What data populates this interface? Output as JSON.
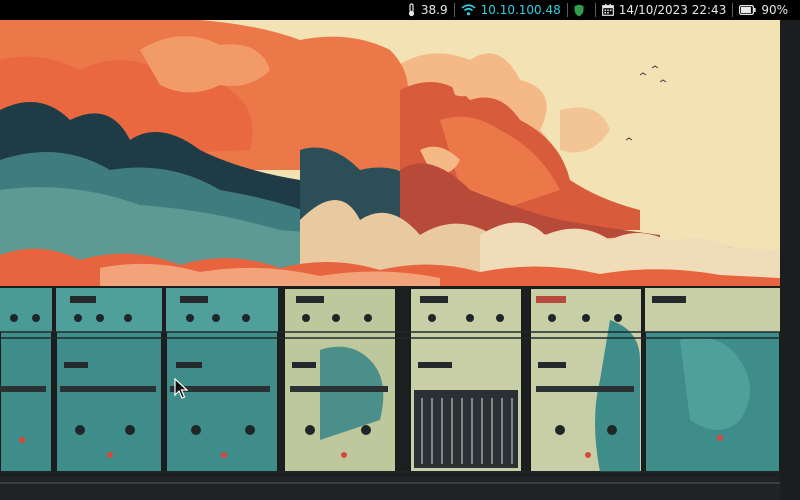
{
  "statusbar": {
    "temperature": {
      "icon": "thermometer-icon",
      "value": "38.9"
    },
    "network": {
      "icon": "wifi-icon",
      "ip": "10.10.100.48",
      "color": "#2fd0e0"
    },
    "vpn": {
      "icon": "shield-icon",
      "color": "#2e9e4a"
    },
    "datetime": {
      "icon": "calendar-icon",
      "value": "14/10/2023 22:43"
    },
    "battery": {
      "icon": "battery-icon",
      "value": "90%",
      "level": 0.9
    }
  },
  "wallpaper": {
    "subject": "great waves above retro control panels",
    "colors": {
      "sky": "#f3e2b3",
      "cloud_orange": "#ec7748",
      "cloud_light": "#f4b987",
      "wave_dark": "#1f3b45",
      "wave_teal": "#3e7c7f",
      "panel_teal": "#3e8d8b",
      "panel_cream": "#c8cfa6",
      "floor": "#202324"
    }
  }
}
